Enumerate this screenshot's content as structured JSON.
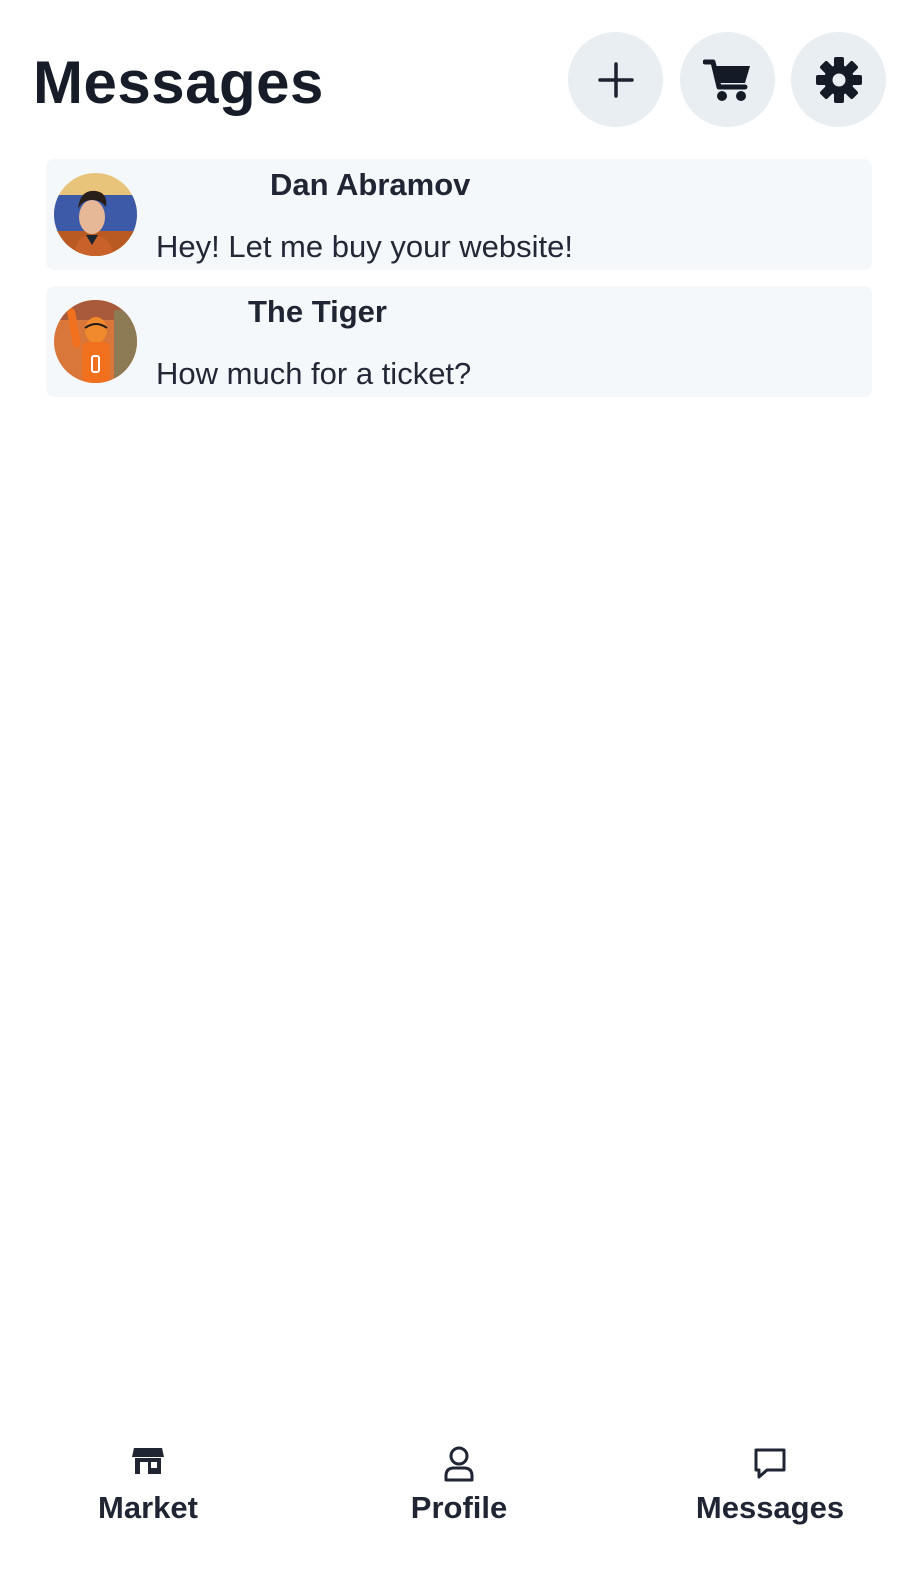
{
  "header": {
    "title": "Messages",
    "buttons": [
      {
        "icon": "plus-icon"
      },
      {
        "icon": "cart-icon"
      },
      {
        "icon": "gear-icon"
      }
    ]
  },
  "messages": [
    {
      "name": "Dan Abramov",
      "text": "Hey! Let me buy your website!",
      "avatar": "avatar-photo"
    },
    {
      "name": "The Tiger",
      "text": "How much for a ticket?",
      "avatar": "avatar-photo"
    }
  ],
  "nav": {
    "items": [
      {
        "label": "Market",
        "icon": "store-icon"
      },
      {
        "label": "Profile",
        "icon": "user-icon"
      },
      {
        "label": "Messages",
        "icon": "chat-bubble-icon"
      }
    ]
  },
  "colors": {
    "background": "#ffffff",
    "button_bg": "#e9eef3",
    "card_bg": "#f5f8fb",
    "text": "#1c2230"
  }
}
